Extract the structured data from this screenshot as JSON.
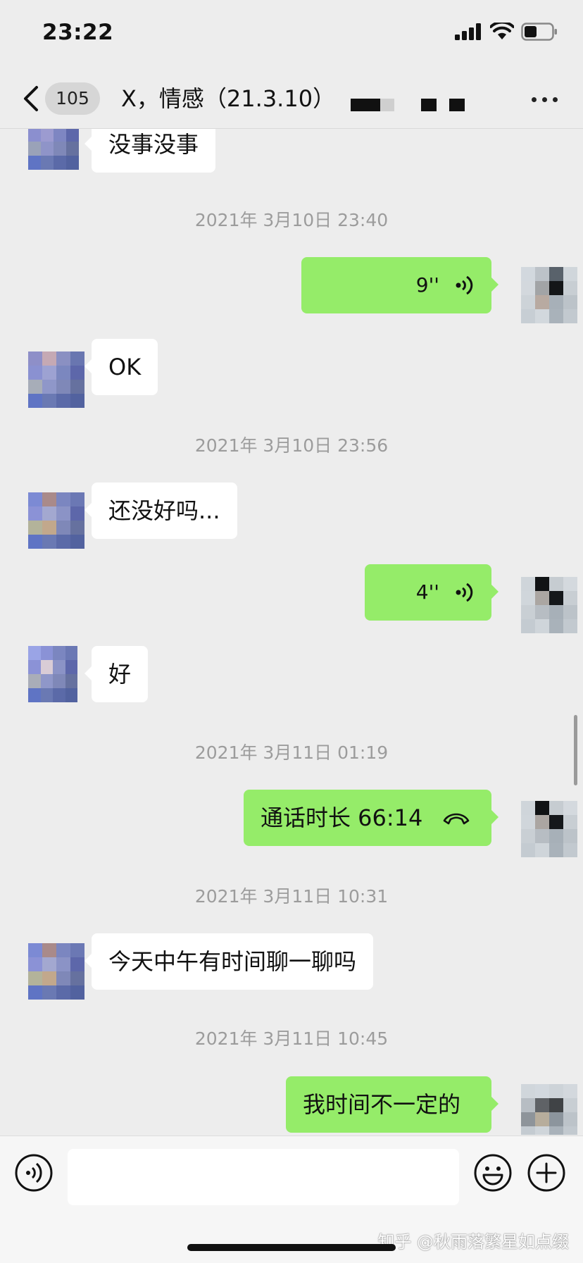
{
  "status_bar": {
    "time": "23:22"
  },
  "nav": {
    "unread_count": "105",
    "title": "X，情感（21.3.10）"
  },
  "messages": [
    {
      "type": "text",
      "side": "in",
      "text": "没事没事"
    },
    {
      "type": "timestamp",
      "text": "2021年 3月10日 23:40"
    },
    {
      "type": "voice",
      "side": "out",
      "duration": "9''"
    },
    {
      "type": "text",
      "side": "in",
      "text": "OK"
    },
    {
      "type": "timestamp",
      "text": "2021年 3月10日 23:56"
    },
    {
      "type": "text",
      "side": "in",
      "text": "还没好吗..."
    },
    {
      "type": "voice",
      "side": "out",
      "duration": "4''"
    },
    {
      "type": "text",
      "side": "in",
      "text": "好"
    },
    {
      "type": "timestamp",
      "text": "2021年 3月11日 01:19"
    },
    {
      "type": "call",
      "side": "out",
      "text": "通话时长 66:14"
    },
    {
      "type": "timestamp",
      "text": "2021年 3月11日 10:31"
    },
    {
      "type": "text",
      "side": "in",
      "text": "今天中午有时间聊一聊吗"
    },
    {
      "type": "timestamp",
      "text": "2021年 3月11日 10:45"
    },
    {
      "type": "text",
      "side": "out",
      "text": "我时间不一定的"
    }
  ],
  "input": {
    "text": ""
  },
  "watermark": "知乎 @秋雨落繁星如点缀",
  "colors": {
    "background": "#ededed",
    "out_bubble": "#95ec69",
    "in_bubble": "#ffffff",
    "timestamp": "#9c9c9c"
  },
  "icons": [
    "back-chevron-icon",
    "more-icon",
    "voice-wave-icon",
    "phone-icon",
    "voice-input-icon",
    "emoji-icon",
    "plus-icon"
  ]
}
